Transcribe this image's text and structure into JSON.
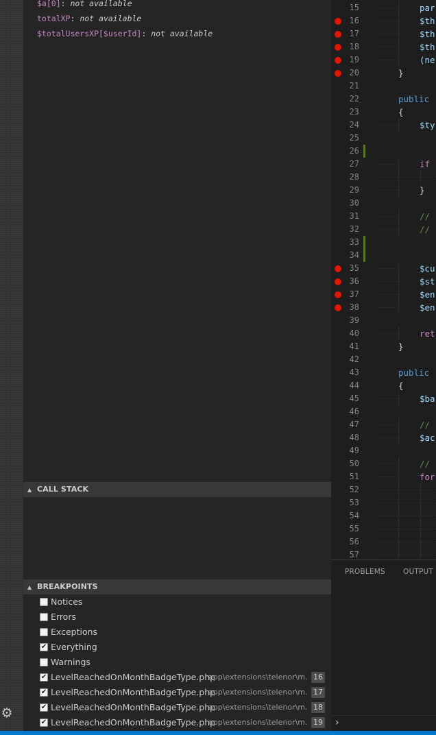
{
  "variables": [
    {
      "name": "$a[0]",
      "value": "not available"
    },
    {
      "name": "totalXP",
      "value": "not available"
    },
    {
      "name": "$totalUsersXP[$userId]",
      "value": "not available"
    }
  ],
  "call_stack": {
    "title": "CALL STACK",
    "twisty": "▲"
  },
  "breakpoints": {
    "title": "BREAKPOINTS",
    "twisty": "▲",
    "items": [
      {
        "label": "Notices",
        "checked": false
      },
      {
        "label": "Errors",
        "checked": false
      },
      {
        "label": "Exceptions",
        "checked": false
      },
      {
        "label": "Everything",
        "checked": true
      },
      {
        "label": "Warnings",
        "checked": false
      },
      {
        "label": "LevelReachedOnMonthBadgeType.php",
        "path": "app\\extensions\\telenor\\m...",
        "line": "16",
        "checked": true
      },
      {
        "label": "LevelReachedOnMonthBadgeType.php",
        "path": "app\\extensions\\telenor\\m...",
        "line": "17",
        "checked": true
      },
      {
        "label": "LevelReachedOnMonthBadgeType.php",
        "path": "app\\extensions\\telenor\\m...",
        "line": "18",
        "checked": true
      },
      {
        "label": "LevelReachedOnMonthBadgeType.php",
        "path": "app\\extensions\\telenor\\m...",
        "line": "19",
        "checked": true
      }
    ]
  },
  "editor": {
    "lines": [
      {
        "n": "15",
        "text": "par",
        "cls": "tok-var",
        "indent": 2,
        "bp": false,
        "mod": false
      },
      {
        "n": "16",
        "text": "$th",
        "cls": "tok-var",
        "indent": 2,
        "bp": true,
        "mod": false
      },
      {
        "n": "17",
        "text": "$th",
        "cls": "tok-var",
        "indent": 2,
        "bp": true,
        "mod": false
      },
      {
        "n": "18",
        "text": "$th",
        "cls": "tok-var",
        "indent": 2,
        "bp": true,
        "mod": false
      },
      {
        "n": "19",
        "text": "(ne",
        "cls": "tok-var",
        "indent": 2,
        "bp": true,
        "mod": false
      },
      {
        "n": "20",
        "text": "}",
        "cls": "tok-punc",
        "indent": 1,
        "bp": true,
        "mod": false
      },
      {
        "n": "21",
        "text": "",
        "cls": "tok-punc",
        "indent": 0,
        "bp": false,
        "mod": false
      },
      {
        "n": "22",
        "text": "public",
        "cls": "tok-kw",
        "indent": 1,
        "bp": false,
        "mod": false
      },
      {
        "n": "23",
        "text": "{",
        "cls": "tok-punc",
        "indent": 1,
        "bp": false,
        "mod": false
      },
      {
        "n": "24",
        "text": "$ty",
        "cls": "tok-var",
        "indent": 2,
        "bp": false,
        "mod": false
      },
      {
        "n": "25",
        "text": "",
        "cls": "tok-punc",
        "indent": 0,
        "bp": false,
        "mod": false
      },
      {
        "n": "26",
        "text": "",
        "cls": "tok-punc",
        "indent": 0,
        "bp": false,
        "mod": true
      },
      {
        "n": "27",
        "text": "if",
        "cls": "tok-ctl",
        "indent": 2,
        "bp": false,
        "mod": false
      },
      {
        "n": "28",
        "text": "",
        "cls": "tok-punc",
        "indent": 3,
        "bp": false,
        "mod": false
      },
      {
        "n": "29",
        "text": "}",
        "cls": "tok-punc",
        "indent": 2,
        "bp": false,
        "mod": false
      },
      {
        "n": "30",
        "text": "",
        "cls": "tok-punc",
        "indent": 0,
        "bp": false,
        "mod": false
      },
      {
        "n": "31",
        "text": "//",
        "cls": "tok-cmt",
        "indent": 2,
        "bp": false,
        "mod": false
      },
      {
        "n": "32",
        "text": "//",
        "cls": "tok-cmt",
        "indent": 2,
        "bp": false,
        "mod": false
      },
      {
        "n": "33",
        "text": "",
        "cls": "tok-punc",
        "indent": 0,
        "bp": false,
        "mod": true
      },
      {
        "n": "34",
        "text": "",
        "cls": "tok-punc",
        "indent": 0,
        "bp": false,
        "mod": true
      },
      {
        "n": "35",
        "text": "$cu",
        "cls": "tok-var",
        "indent": 2,
        "bp": true,
        "mod": false
      },
      {
        "n": "36",
        "text": "$st",
        "cls": "tok-var",
        "indent": 2,
        "bp": true,
        "mod": false
      },
      {
        "n": "37",
        "text": "$en",
        "cls": "tok-var",
        "indent": 2,
        "bp": true,
        "mod": false
      },
      {
        "n": "38",
        "text": "$en",
        "cls": "tok-var",
        "indent": 2,
        "bp": true,
        "mod": false
      },
      {
        "n": "39",
        "text": "",
        "cls": "tok-punc",
        "indent": 0,
        "bp": false,
        "mod": false
      },
      {
        "n": "40",
        "text": "ret",
        "cls": "tok-ctl",
        "indent": 2,
        "bp": false,
        "mod": false
      },
      {
        "n": "41",
        "text": "}",
        "cls": "tok-punc",
        "indent": 1,
        "bp": false,
        "mod": false
      },
      {
        "n": "42",
        "text": "",
        "cls": "tok-punc",
        "indent": 0,
        "bp": false,
        "mod": false
      },
      {
        "n": "43",
        "text": "public",
        "cls": "tok-kw",
        "indent": 1,
        "bp": false,
        "mod": false
      },
      {
        "n": "44",
        "text": "{",
        "cls": "tok-punc",
        "indent": 1,
        "bp": false,
        "mod": false
      },
      {
        "n": "45",
        "text": "$ba",
        "cls": "tok-var",
        "indent": 2,
        "bp": false,
        "mod": false
      },
      {
        "n": "46",
        "text": "",
        "cls": "tok-punc",
        "indent": 0,
        "bp": false,
        "mod": false
      },
      {
        "n": "47",
        "text": "//",
        "cls": "tok-cmt",
        "indent": 2,
        "bp": false,
        "mod": false
      },
      {
        "n": "48",
        "text": "$ac",
        "cls": "tok-var",
        "indent": 2,
        "bp": false,
        "mod": false
      },
      {
        "n": "49",
        "text": "",
        "cls": "tok-punc",
        "indent": 0,
        "bp": false,
        "mod": false
      },
      {
        "n": "50",
        "text": "//",
        "cls": "tok-cmt",
        "indent": 2,
        "bp": false,
        "mod": false
      },
      {
        "n": "51",
        "text": "for",
        "cls": "tok-ctl",
        "indent": 2,
        "bp": false,
        "mod": false
      },
      {
        "n": "52",
        "text": "",
        "cls": "tok-punc",
        "indent": 3,
        "bp": false,
        "mod": false
      },
      {
        "n": "53",
        "text": "",
        "cls": "tok-punc",
        "indent": 3,
        "bp": false,
        "mod": false
      },
      {
        "n": "54",
        "text": "",
        "cls": "tok-punc",
        "indent": 3,
        "bp": false,
        "mod": false
      },
      {
        "n": "55",
        "text": "",
        "cls": "tok-punc",
        "indent": 3,
        "bp": false,
        "mod": false
      },
      {
        "n": "56",
        "text": "",
        "cls": "tok-punc",
        "indent": 3,
        "bp": false,
        "mod": false
      },
      {
        "n": "57",
        "text": "",
        "cls": "tok-punc",
        "indent": 3,
        "bp": false,
        "mod": false
      }
    ]
  },
  "panel": {
    "tabs": [
      "PROBLEMS",
      "OUTPUT"
    ],
    "prompt": "›"
  },
  "icons": {
    "settings": "gear-icon",
    "twisty": "triangle-up-icon",
    "breakpoint": "breakpoint-dot-icon"
  },
  "colors": {
    "breakpoint": "#e51400",
    "status_bar": "#007acc",
    "modified_gutter": "#587c0c",
    "variable_name": "#c586c0"
  }
}
